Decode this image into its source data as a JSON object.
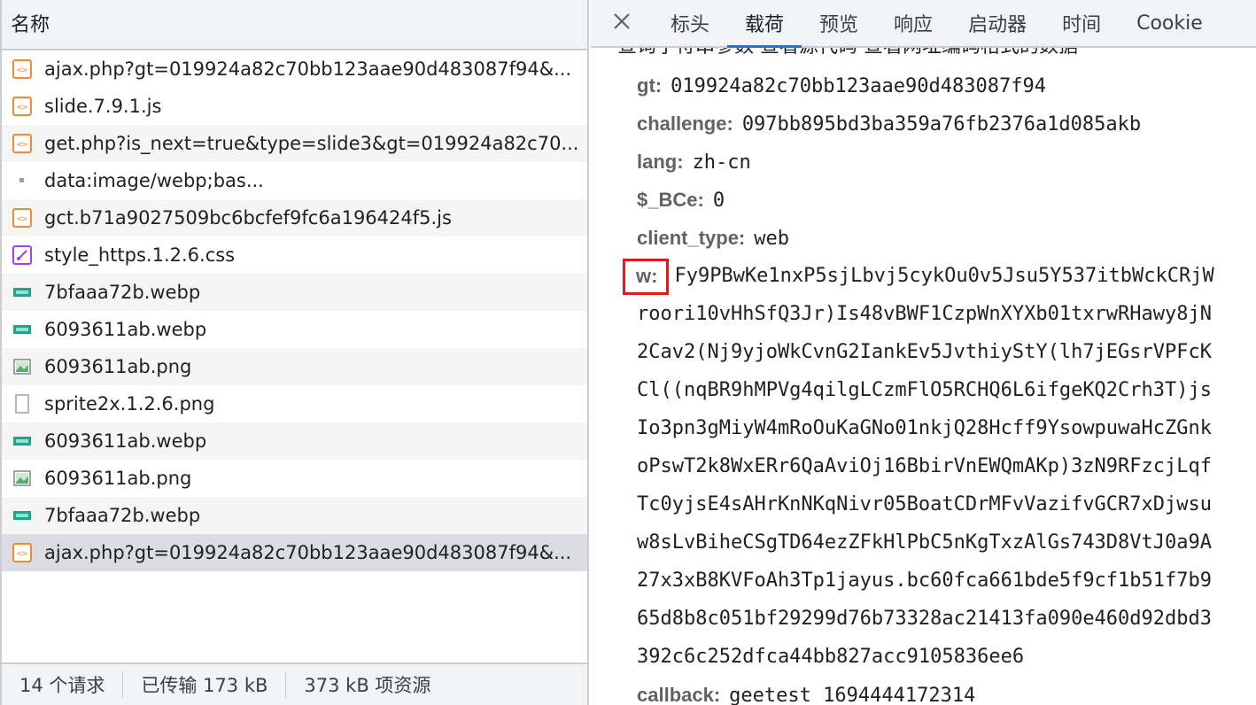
{
  "left": {
    "header": "名称",
    "requests": [
      {
        "name": "ajax.php?gt=019924a82c70bb123aae90d483087f94&...",
        "icon": "script-icon"
      },
      {
        "name": "slide.7.9.1.js",
        "icon": "script-icon"
      },
      {
        "name": "get.php?is_next=true&type=slide3&gt=019924a82c70...",
        "icon": "script-icon"
      },
      {
        "name": "data:image/webp;bas...",
        "icon": "dot-icon"
      },
      {
        "name": "gct.b71a9027509bc6bcfef9fc6a196424f5.js",
        "icon": "script-icon"
      },
      {
        "name": "style_https.1.2.6.css",
        "icon": "stylesheet-icon"
      },
      {
        "name": "7bfaaa72b.webp",
        "icon": "image-webp-icon"
      },
      {
        "name": "6093611ab.webp",
        "icon": "image-webp-icon"
      },
      {
        "name": "6093611ab.png",
        "icon": "image-png-icon"
      },
      {
        "name": "sprite2x.1.2.6.png",
        "icon": "blank-file-icon"
      },
      {
        "name": "6093611ab.webp",
        "icon": "image-webp-icon"
      },
      {
        "name": "6093611ab.png",
        "icon": "image-png-icon"
      },
      {
        "name": "7bfaaa72b.webp",
        "icon": "image-webp-icon"
      },
      {
        "name": "ajax.php?gt=019924a82c70bb123aae90d483087f94&...",
        "icon": "script-icon"
      }
    ],
    "status": {
      "requests": "14 个请求",
      "transferred": "已传输 173 kB",
      "resources": "373 kB 项资源"
    }
  },
  "right": {
    "tabs": [
      "标头",
      "载荷",
      "预览",
      "响应",
      "启动器",
      "时间",
      "Cookie"
    ],
    "active_tab": "载荷",
    "cut_line": "查询字符串参数    查看源代码    查看网址编码格式的数据",
    "params": {
      "gt": {
        "key": "gt:",
        "value": "019924a82c70bb123aae90d483087f94"
      },
      "challenge": {
        "key": "challenge:",
        "value": "097bb895bd3ba359a76fb2376a1d085akb"
      },
      "lang": {
        "key": "lang:",
        "value": "zh-cn"
      },
      "bce": {
        "key": "$_BCe:",
        "value": "0"
      },
      "client_type": {
        "key": "client_type:",
        "value": "web"
      },
      "w": {
        "key": "w:",
        "lines": [
          "Fy9PBwKe1nxP5sjLbvj5cykOu0v5Jsu5Y537itbWckCRjW",
          "roori10vHhSfQ3Jr)Is48vBWF1CzpWnXYXb01txrwRHawy8jN",
          "2Cav2(Nj9yjoWkCvnG2IankEv5JvthiyStY(lh7jEGsrVPFcK",
          "Cl((nqBR9hMPVg4qilgLCzmFlO5RCHQ6L6ifgeKQ2Crh3T)js",
          "Io3pn3gMiyW4mRoOuKaGNo01nkjQ28Hcff9YsowpuwaHcZGnk",
          "oPswT2k8WxERr6QaAviOj16BbirVnEWQmAKp)3zN9RFzcjLqf",
          "Tc0yjsE4sAHrKnNKqNivr05BoatCDrMFvVazifvGCR7xDjwsu",
          "w8sLvBiheCSgTD64ezZFkHlPbC5nKgTxzAlGs743D8VtJ0a9A",
          "27x3xB8KVFoAh3Tp1jayus.bc60fca661bde5f9cf1b51f7b9",
          "65d8b8c051bf29299d76b73328ac21413fa090e460d92dbd3",
          "392c6c252dfca44bb827acc9105836ee6"
        ]
      },
      "callback": {
        "key": "callback:",
        "value": "geetest_1694444172314"
      }
    }
  },
  "colors": {
    "accent": "#1a73e8",
    "highlight_box": "#e01b1b",
    "script_icon": "#f28b30",
    "stylesheet_icon": "#a142f4",
    "image_icon": "#1ea58a"
  }
}
